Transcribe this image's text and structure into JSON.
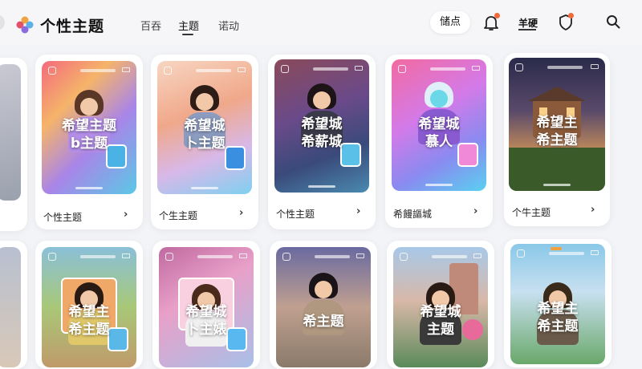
{
  "app": {
    "title": "个性主题"
  },
  "nav": [
    {
      "label": "百吞"
    },
    {
      "label": "主题"
    },
    {
      "label": "诺动"
    }
  ],
  "header": {
    "pill_label": "储点",
    "user_label": "羊硬"
  },
  "colors": {
    "accent": "#f06a3a",
    "background": "#f3f4f7",
    "card": "#ffffff"
  },
  "icons": [
    "logo-icon",
    "bell-icon",
    "shield-icon",
    "search-icon"
  ],
  "cards_row1": [
    {
      "label": "",
      "overlay": []
    },
    {
      "label": "个性主题",
      "overlay": [
        "希望主题",
        "b主题"
      ]
    },
    {
      "label": "个生主题",
      "overlay": [
        "希望城",
        "卜主题"
      ]
    },
    {
      "label": "个性主题",
      "overlay": [
        "希望城",
        "希薪城"
      ]
    },
    {
      "label": "希饅謳城",
      "overlay": [
        "希望城",
        "慕人"
      ]
    },
    {
      "label": "个牛主题",
      "overlay": [
        "希望主",
        "希主题"
      ]
    }
  ],
  "cards_row2": [
    {
      "overlay": []
    },
    {
      "overlay": [
        "希望主",
        "希主题"
      ]
    },
    {
      "overlay": [
        "希望城",
        "卜主婊"
      ]
    },
    {
      "overlay": [
        "希主题"
      ]
    },
    {
      "overlay": [
        "希望城",
        "主题"
      ]
    },
    {
      "overlay": [
        "希望主",
        "希主题"
      ]
    }
  ]
}
